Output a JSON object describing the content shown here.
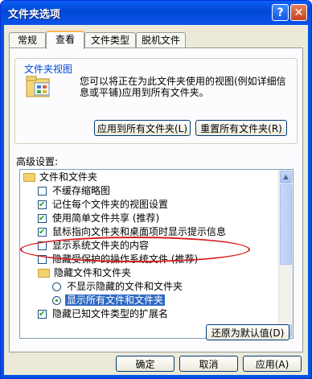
{
  "window": {
    "title": "文件夹选项",
    "help_glyph": "?",
    "close_glyph": "✕"
  },
  "tabs": [
    {
      "label": "常规"
    },
    {
      "label": "查看"
    },
    {
      "label": "文件类型"
    },
    {
      "label": "脱机文件"
    }
  ],
  "folder_views": {
    "label": "文件夹视图",
    "description": "您可以将正在为此文件夹使用的视图(例如详细信息或平铺)应用到所有文件夹。",
    "apply_all_label": "应用到所有文件夹(L)",
    "reset_all_label": "重置所有文件夹(R)"
  },
  "advanced": {
    "label": "高级设置:",
    "items": [
      {
        "kind": "folder",
        "label": "文件和文件夹"
      },
      {
        "kind": "checkbox",
        "checked": false,
        "label": "不缓存缩略图"
      },
      {
        "kind": "checkbox",
        "checked": true,
        "label": "记住每个文件夹的视图设置"
      },
      {
        "kind": "checkbox",
        "checked": true,
        "label": "使用简单文件共享 (推荐)"
      },
      {
        "kind": "checkbox",
        "checked": true,
        "label": "鼠标指向文件夹和桌面项时显示提示信息"
      },
      {
        "kind": "checkbox",
        "checked": false,
        "label": "显示系统文件夹的内容"
      },
      {
        "kind": "checkbox",
        "checked": false,
        "label": "隐藏受保护的操作系统文件 (推荐)"
      },
      {
        "kind": "folder",
        "label": "隐藏文件和文件夹"
      },
      {
        "kind": "radio",
        "selected": false,
        "label": "不显示隐藏的文件和文件夹"
      },
      {
        "kind": "radio",
        "selected": true,
        "label": "显示所有文件和文件夹"
      },
      {
        "kind": "checkbox",
        "checked": true,
        "label": "隐藏已知文件类型的扩展名"
      }
    ]
  },
  "restore_defaults_label": "还原为默认值(D)",
  "footer": {
    "ok": "确定",
    "cancel": "取消",
    "apply": "应用(A)"
  },
  "colors": {
    "selection": "#316ac5",
    "annotation": "#d42020",
    "title_bar": "#0a5ff4"
  }
}
